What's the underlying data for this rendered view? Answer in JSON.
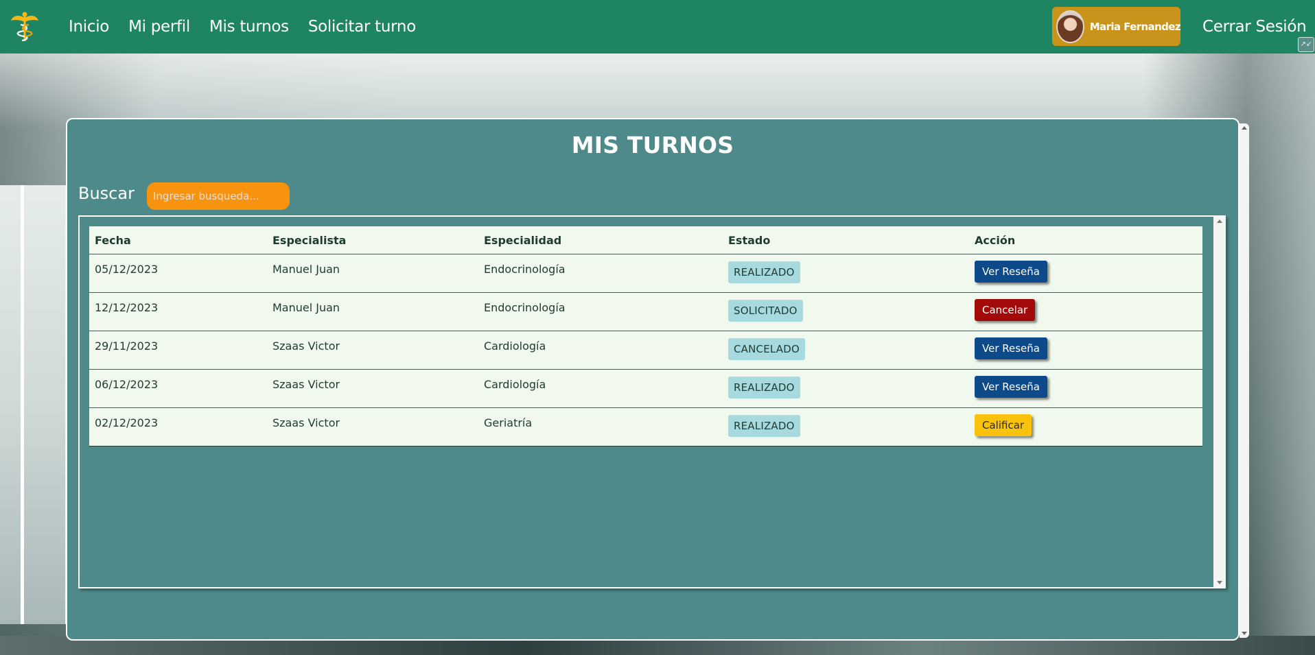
{
  "nav": {
    "links": [
      "Inicio",
      "Mi perfil",
      "Mis turnos",
      "Solicitar turno"
    ],
    "user_name": "Maria Fernandez",
    "logout": "Cerrar Sesión"
  },
  "page": {
    "title": "MIS TURNOS",
    "search_label": "Buscar",
    "search_placeholder": "Ingresar busqueda..."
  },
  "table": {
    "headers": [
      "Fecha",
      "Especialista",
      "Especialidad",
      "Estado",
      "Acción"
    ],
    "rows": [
      {
        "fecha": "05/12/2023",
        "especialista": "Manuel Juan",
        "especialidad": "Endocrinología",
        "estado": "REALIZADO",
        "accion": "Ver Reseña",
        "accion_color": "#0d4a8a"
      },
      {
        "fecha": "12/12/2023",
        "especialista": "Manuel Juan",
        "especialidad": "Endocrinología",
        "estado": "SOLICITADO",
        "accion": "Cancelar",
        "accion_color": "#a30a0a"
      },
      {
        "fecha": "29/11/2023",
        "especialista": "Szaas Victor",
        "especialidad": "Cardiología",
        "estado": "CANCELADO",
        "accion": "Ver Reseña",
        "accion_color": "#0d4a8a"
      },
      {
        "fecha": "06/12/2023",
        "especialista": "Szaas Victor",
        "especialidad": "Cardiología",
        "estado": "REALIZADO",
        "accion": "Ver Reseña",
        "accion_color": "#0d4a8a"
      },
      {
        "fecha": "02/12/2023",
        "especialista": "Szaas Victor",
        "especialidad": "Geriatría",
        "estado": "REALIZADO",
        "accion": "Calificar",
        "accion_color": "#f8c20d"
      }
    ]
  },
  "icons": {
    "logo": "caduceus-icon",
    "corner": "resize-icon"
  },
  "colors": {
    "navbar": "#1f8461",
    "card": "#4f8a8b",
    "search": "#f7930f",
    "user_chip": "#c8941c",
    "badge": "#a6dade"
  }
}
